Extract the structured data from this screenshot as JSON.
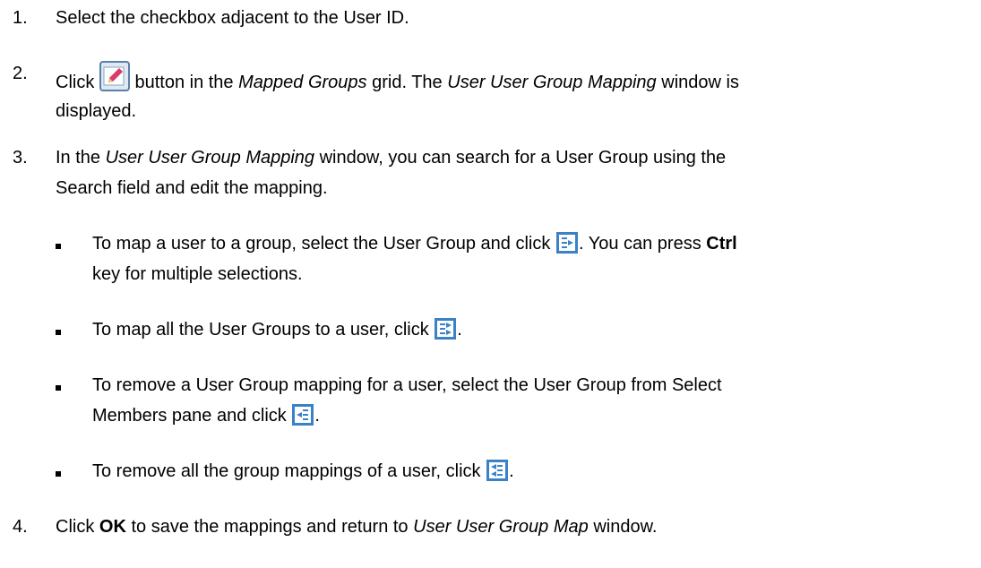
{
  "steps": [
    {
      "number": "1.",
      "text": "Select the checkbox adjacent to the User ID."
    },
    {
      "number": "2.",
      "pre": "Click",
      "post": "button in the",
      "em1": "Mapped Groups",
      "mid": "grid. The",
      "em2": "User User Group Mapping",
      "end": "window is",
      "line2": "displayed.",
      "icon": "edit-icon"
    },
    {
      "number": "3.",
      "pre": "In the",
      "em1": "User User Group Mapping",
      "post": "window, you can search for a User Group using the",
      "line2": "Search field and edit the mapping."
    },
    {
      "number": "4.",
      "pre": "Click",
      "bold": "OK",
      "post": "to save the mappings and return to",
      "em1": "User User Group Map",
      "end": "window."
    }
  ],
  "bullets": [
    {
      "pre": "To map a user to a group, select the User Group and click",
      "post": ". You can press",
      "bold": "Ctrl",
      "line2": "key for multiple selections.",
      "icon": "map-selected-icon"
    },
    {
      "pre": "To map all the User Groups to a user, click",
      "post": ".",
      "icon": "map-all-icon"
    },
    {
      "pre": "To remove a User Group mapping for a user, select the User Group from Select",
      "line2": "Members pane and click",
      "post": ".",
      "icon": "remove-selected-icon"
    },
    {
      "pre": "To remove all the group mappings of a user, click",
      "post": ".",
      "icon": "remove-all-icon"
    }
  ]
}
